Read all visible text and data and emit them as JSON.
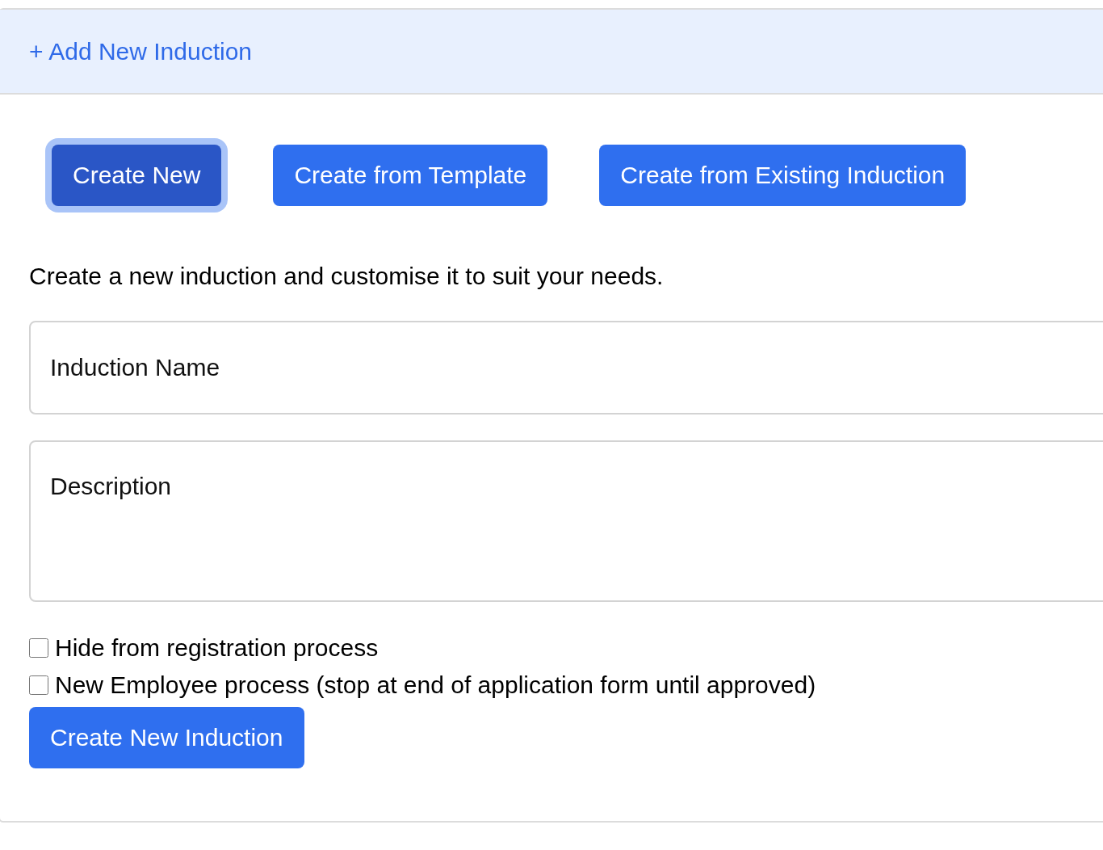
{
  "header": {
    "title": "+ Add New Induction"
  },
  "modes": [
    {
      "label": "Create New",
      "selected": true
    },
    {
      "label": "Create from Template",
      "selected": false
    },
    {
      "label": "Create from Existing Induction",
      "selected": false
    }
  ],
  "intro": "Create a new induction and customise it to suit your needs.",
  "name_field": {
    "placeholder": "Induction Name"
  },
  "description_field": {
    "placeholder": "Description"
  },
  "options": [
    {
      "label": "Hide from registration process",
      "checked": false
    },
    {
      "label": "New Employee process (stop at end of application form until approved)",
      "checked": false
    }
  ],
  "submit": {
    "label": "Create New Induction"
  }
}
